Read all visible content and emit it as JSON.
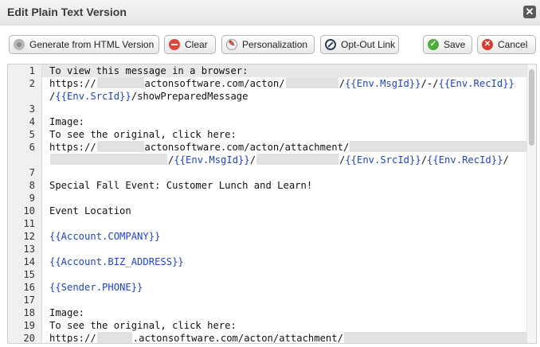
{
  "dialog": {
    "title": "Edit Plain Text Version",
    "close_label": "✕"
  },
  "toolbar": {
    "generate_label": "Generate from HTML Version",
    "clear_label": "Clear",
    "personalization_label": "Personalization",
    "optout_label": "Opt-Out Link",
    "save_label": "Save",
    "cancel_label": "Cancel"
  },
  "colors": {
    "token": "#1c45c8",
    "gutter": "#f0f0f0",
    "active_line": "#e8e8e8"
  },
  "editor": {
    "lines": [
      {
        "n": "1",
        "segs": [
          {
            "t": "To view this message in a browser:"
          }
        ]
      },
      {
        "n": "2",
        "segs": [
          {
            "t": "https://"
          },
          {
            "r": 8
          },
          {
            "t": "actonsoftware.com/acton/"
          },
          {
            "r": 9
          },
          {
            "t": "/"
          },
          {
            "k": "{{Env.MsgId}}"
          },
          {
            "t": "/-/"
          },
          {
            "k": "{{Env.RecId}}"
          }
        ]
      },
      {
        "n": "",
        "segs": [
          {
            "t": "/"
          },
          {
            "k": "{{Env.SrcId}}"
          },
          {
            "t": "/showPreparedMessage"
          }
        ]
      },
      {
        "n": "3",
        "segs": []
      },
      {
        "n": "4",
        "segs": [
          {
            "t": "Image:"
          }
        ]
      },
      {
        "n": "5",
        "segs": [
          {
            "t": "To see the original, click here:"
          }
        ]
      },
      {
        "n": "6",
        "segs": [
          {
            "t": "https://"
          },
          {
            "r": 8
          },
          {
            "t": "actonsoftware.com/acton/attachment/"
          },
          {
            "r": 32
          }
        ]
      },
      {
        "n": "",
        "segs": [
          {
            "r": 20
          },
          {
            "t": "/"
          },
          {
            "k": "{{Env.MsgId}}"
          },
          {
            "t": "/"
          },
          {
            "r": 14
          },
          {
            "t": "/"
          },
          {
            "k": "{{Env.SrcId}}"
          },
          {
            "t": "/"
          },
          {
            "k": "{{Env.RecId}}"
          },
          {
            "t": "/"
          }
        ]
      },
      {
        "n": "7",
        "segs": []
      },
      {
        "n": "8",
        "segs": [
          {
            "t": "Special Fall Event: Customer Lunch and Learn!"
          }
        ]
      },
      {
        "n": "9",
        "segs": []
      },
      {
        "n": "10",
        "segs": [
          {
            "t": "Event Location"
          }
        ]
      },
      {
        "n": "11",
        "segs": []
      },
      {
        "n": "12",
        "segs": [
          {
            "k": "{{Account.COMPANY}}"
          }
        ]
      },
      {
        "n": "13",
        "segs": []
      },
      {
        "n": "14",
        "segs": [
          {
            "k": "{{Account.BIZ_ADDRESS}}"
          }
        ]
      },
      {
        "n": "15",
        "segs": []
      },
      {
        "n": "16",
        "segs": [
          {
            "k": "{{Sender.PHONE}}"
          }
        ]
      },
      {
        "n": "17",
        "segs": []
      },
      {
        "n": "18",
        "segs": [
          {
            "t": "Image:"
          }
        ]
      },
      {
        "n": "19",
        "segs": [
          {
            "t": "To see the original, click here:"
          }
        ]
      },
      {
        "n": "20",
        "segs": [
          {
            "t": "https://"
          },
          {
            "r": 6
          },
          {
            "t": ".actonsoftware.com/acton/attachment/"
          },
          {
            "r": 32
          }
        ]
      }
    ]
  }
}
